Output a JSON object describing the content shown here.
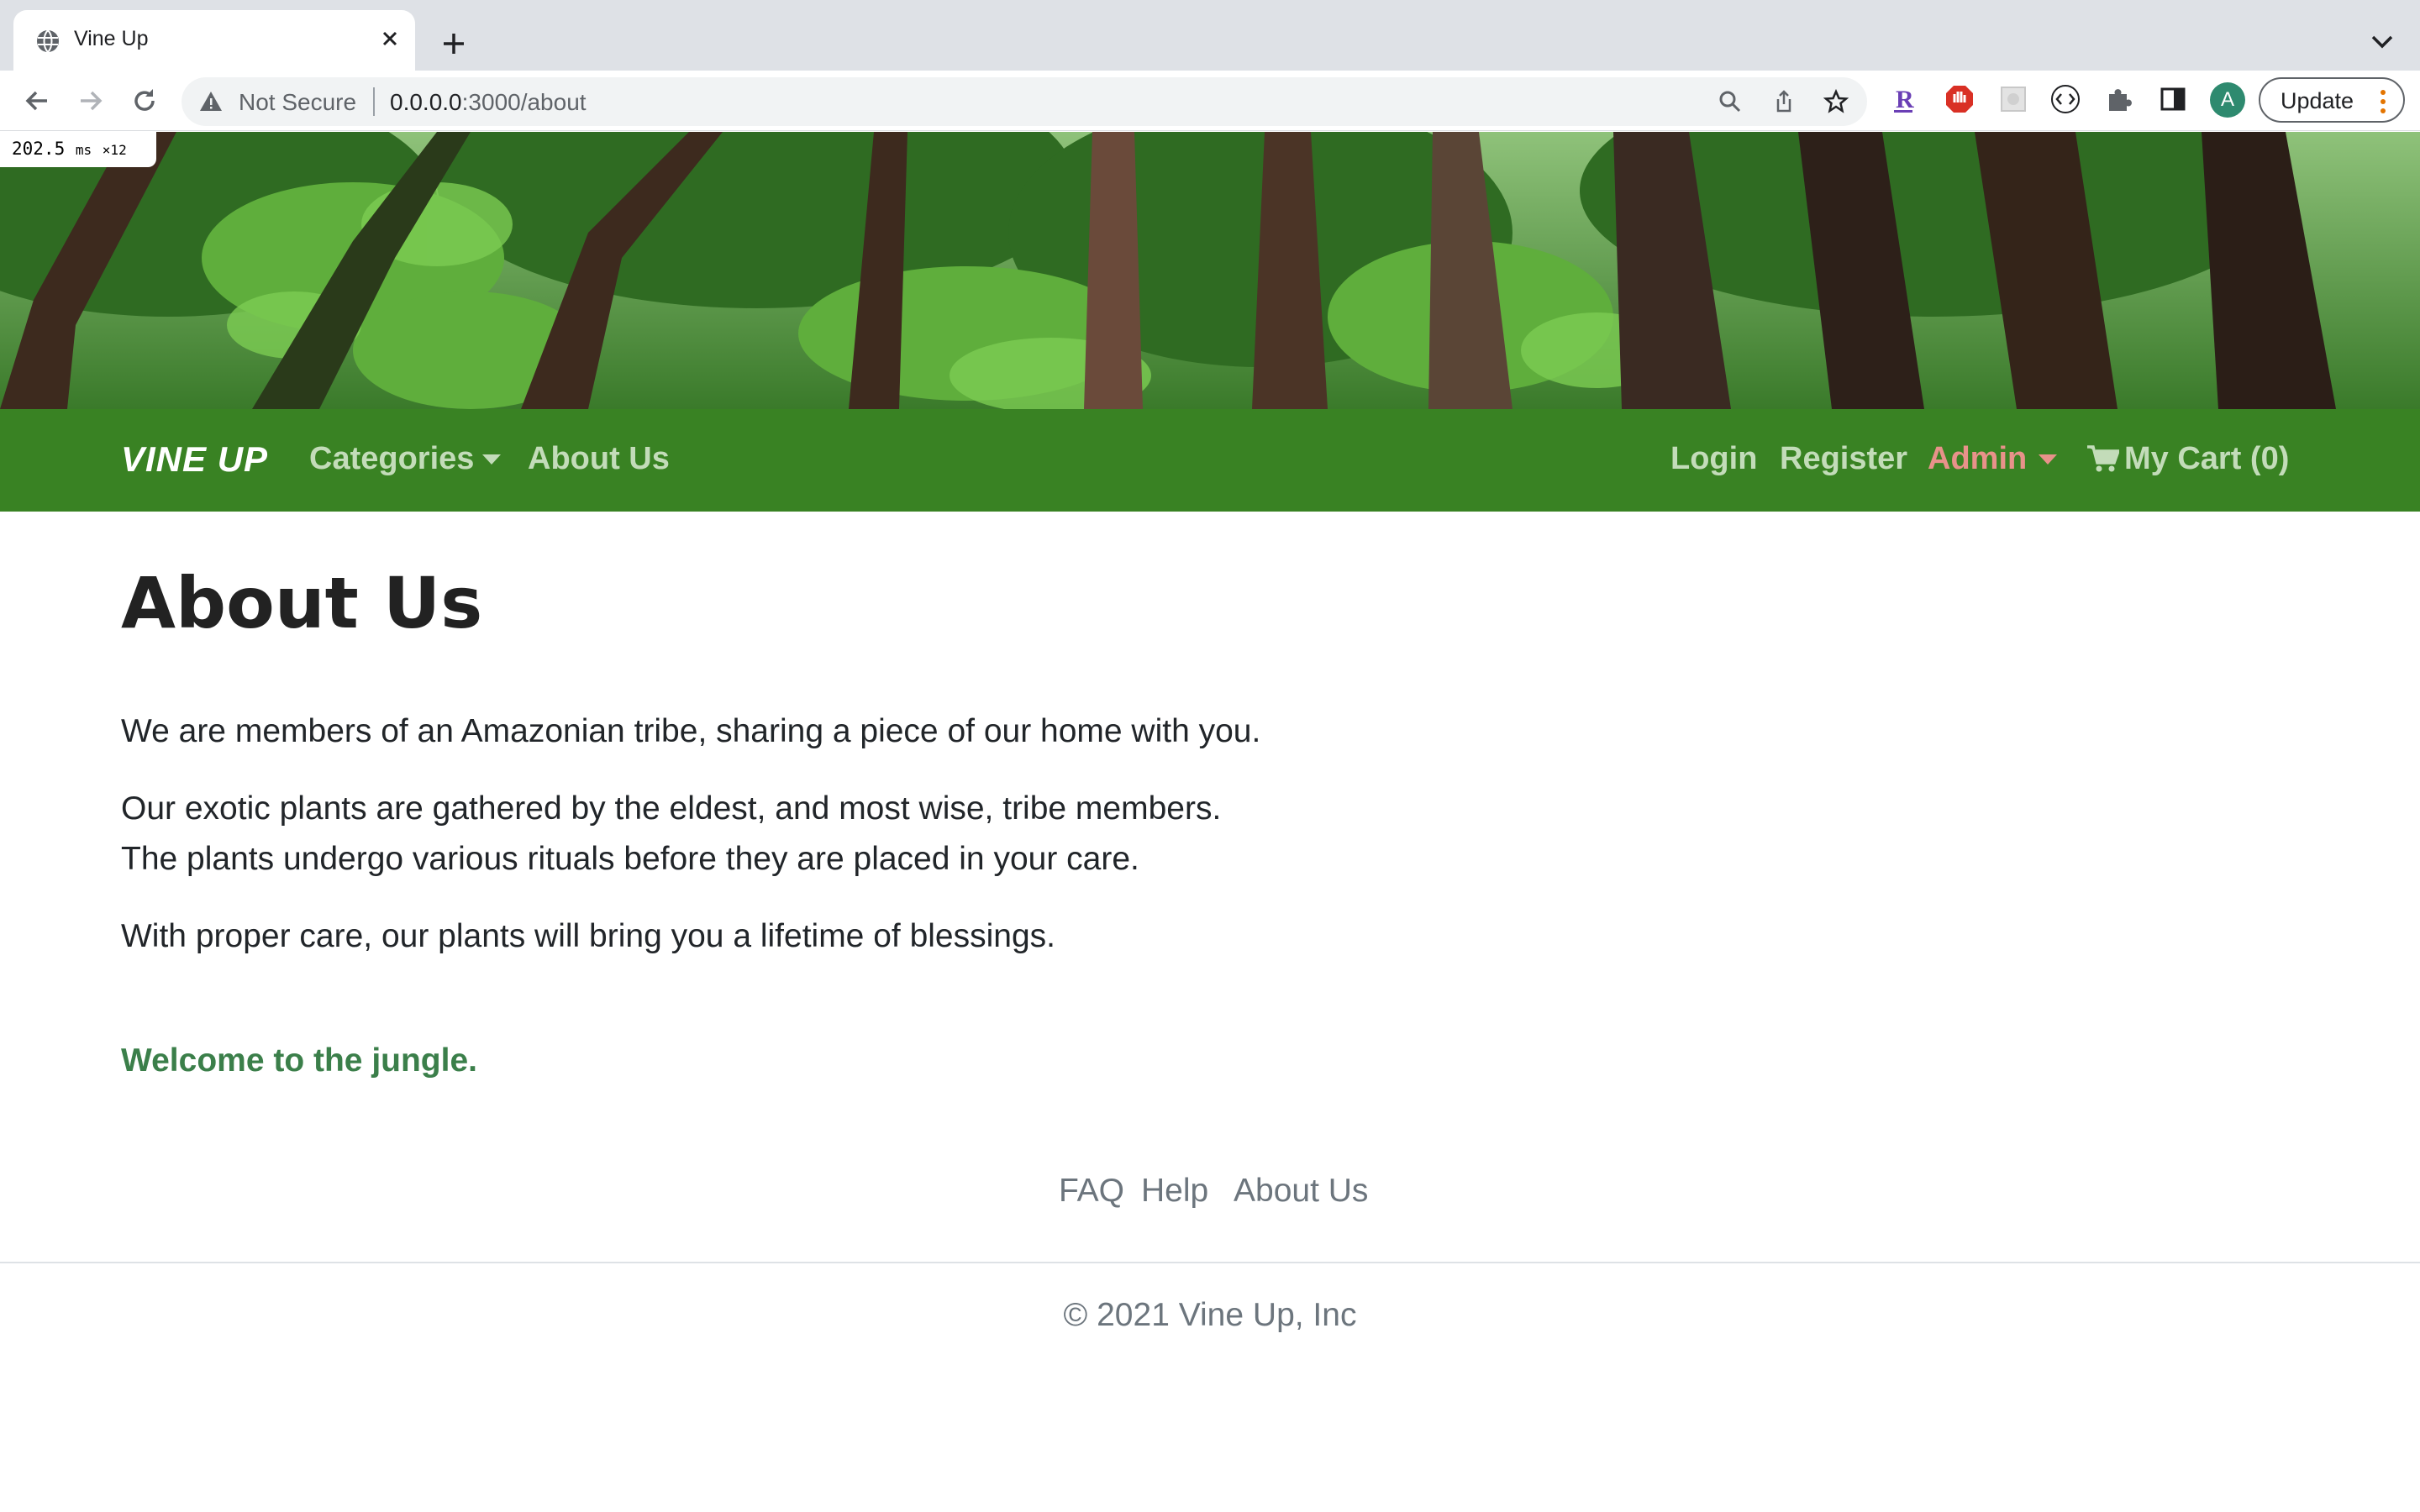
{
  "browser": {
    "tab_title": "Vine Up",
    "security_label": "Not Secure",
    "url_host": "0.0.0.0",
    "url_rest": ":3000/about",
    "update_label": "Update",
    "profile_initial": "A",
    "perf_value": "202.5",
    "perf_unit": "ms",
    "perf_count": "×12"
  },
  "nav": {
    "brand": "VINE UP",
    "categories": "Categories",
    "about": "About Us",
    "login": "Login",
    "register": "Register",
    "admin": "Admin",
    "cart": "My Cart (0)"
  },
  "main": {
    "title": "About Us",
    "p1": "We are members of an Amazonian tribe, sharing a piece of our home with you.",
    "p2_line1": "Our exotic plants are gathered by the eldest, and most wise, tribe members.",
    "p2_line2": "The plants undergo various rituals before they are placed in your care.",
    "p3": "With proper care, our plants will bring you a lifetime of blessings.",
    "welcome": "Welcome to the jungle."
  },
  "footer": {
    "links": [
      "FAQ",
      "Help",
      "About Us"
    ],
    "copyright": "© 2021 Vine Up, Inc"
  },
  "colors": {
    "nav_bg": "#398223",
    "nav_link": "#c3dcb9",
    "admin_link": "#e8928a",
    "welcome_text": "#3b7f4a"
  }
}
